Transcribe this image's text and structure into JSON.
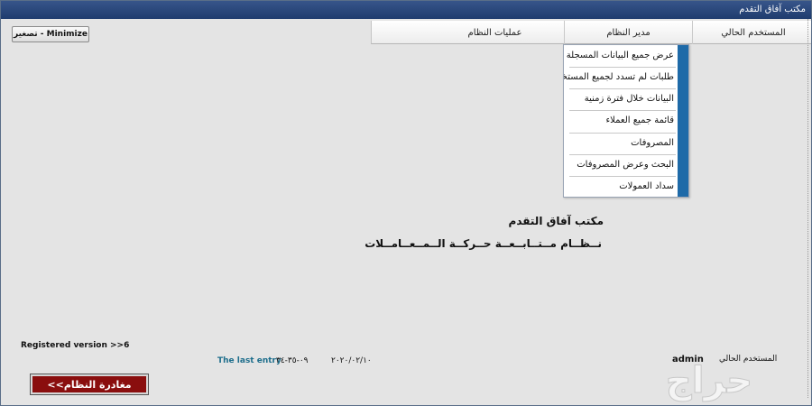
{
  "window": {
    "title": "مكتب آفاق التقدم"
  },
  "toolbar": {
    "minimize_label": "تصغير - Minimize"
  },
  "menu": {
    "items": [
      {
        "label": "المستخدم الحالي"
      },
      {
        "label": "مدير النظام"
      },
      {
        "label": "عمليات النظام"
      }
    ]
  },
  "dropdown": {
    "items": [
      {
        "label": "عرض جميع البيانات المسجلة"
      },
      {
        "label": "طلبات لم تسدد لجميع المستخدمين"
      },
      {
        "label": "البيانات خلال فترة زمنية"
      },
      {
        "label": "قائمة جميع العملاء"
      },
      {
        "label": "المصروفات"
      },
      {
        "label": "البحث وعرض المصروفات"
      },
      {
        "label": "سداد العمولات"
      }
    ]
  },
  "main": {
    "office_name": "مكتب آفاق التقدم",
    "system_name": "نــظــام مــتــابــعــة حــركــة الــمــعــامــلات"
  },
  "footer": {
    "registered_version": "Registered version  >>6",
    "last_entry_label": "The last entry",
    "last_entry_time": "٠٩-٣٥-٣٤",
    "last_entry_date": "٢٠٢٠/٠٢/١٠",
    "current_user_label": "المستخدم الحالي",
    "current_user_value": "admin",
    "exit_label": "مغادرة النظام>>"
  },
  "watermark": {
    "text": "حراج"
  },
  "colors": {
    "accent": "#1e6aa8",
    "titlebar": "#1f3c6e",
    "exit": "#8a0e0e"
  }
}
